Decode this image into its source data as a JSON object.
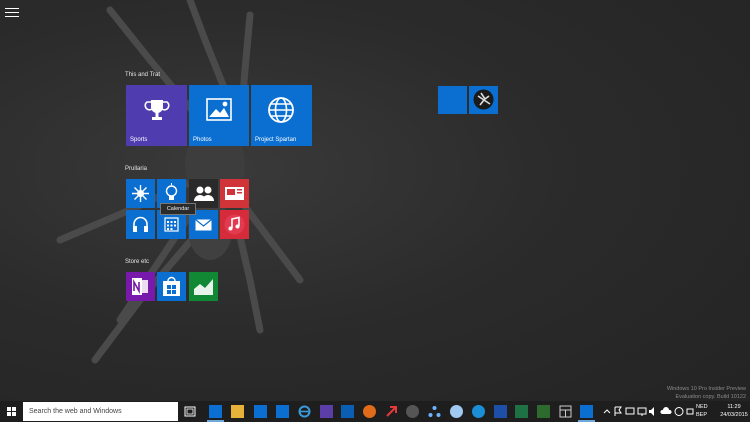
{
  "start": {
    "menu_button_icon": "hamburger-icon",
    "groups": [
      {
        "label": "This and Trat"
      },
      {
        "label": "Prullaria"
      },
      {
        "label": "Store etc"
      }
    ],
    "tiles": {
      "sports": {
        "label": "Sports",
        "color": "#4f3db0",
        "icon": "trophy-icon"
      },
      "photos": {
        "label": "Photos",
        "color": "#0a6fd1",
        "icon": "photos-icon"
      },
      "spartan": {
        "label": "Project Spartan",
        "color": "#0a6fd1",
        "icon": "globe-icon"
      }
    },
    "tooltip": "Calendar"
  },
  "watermark": {
    "line1": "Windows 10 Pro Insider Preview",
    "line2": "Evaluation copy. Build 10122"
  },
  "taskbar": {
    "search_placeholder": "Search the web and Windows",
    "lang_line1": "NED",
    "lang_line2": "BEP",
    "time": "11:29",
    "date": "24/03/2015",
    "accent": "#0a6fd1"
  }
}
